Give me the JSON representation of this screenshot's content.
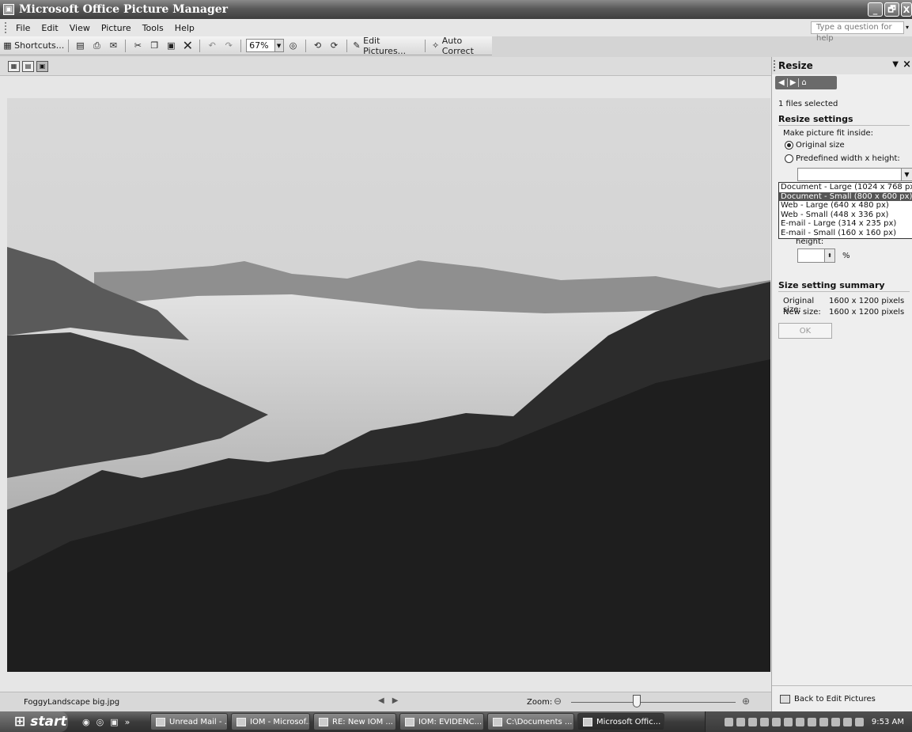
{
  "window": {
    "title": "Microsoft Office Picture Manager",
    "controls": {
      "minimize": "_",
      "maximize": "🗗",
      "close": "X"
    }
  },
  "menu": {
    "items": [
      "File",
      "Edit",
      "View",
      "Picture",
      "Tools",
      "Help"
    ],
    "help_placeholder": "Type a question for help"
  },
  "toolbar": {
    "shortcuts_label": "Shortcuts...",
    "zoom_value": "67%",
    "edit_pictures_label": "Edit Pictures...",
    "auto_correct_label": "Auto Correct"
  },
  "status": {
    "filename": "FoggyLandscape big.jpg",
    "zoom_label": "Zoom:"
  },
  "pane": {
    "title": "Resize",
    "files_selected": "1 files selected",
    "resize_settings_header": "Resize settings",
    "fit_label": "Make picture fit inside:",
    "options": [
      {
        "label": "Original size",
        "selected": true
      },
      {
        "label": "Predefined width x height:",
        "selected": false
      }
    ],
    "predefined_list": [
      "Document - Large (1024 x 768 px)",
      "Document - Small (800 x 600 px)",
      "Web - Large (640 x 480 px)",
      "Web - Small (448 x 336 px)",
      "E-mail - Large (314 x 235 px)",
      "E-mail - Small (160 x 160 px)"
    ],
    "highlighted_index": 1,
    "height_label": "height:",
    "percent_sign": "%",
    "summary_header": "Size setting summary",
    "original_size_label": "Original size:",
    "original_size_value": "1600 x 1200 pixels",
    "new_size_label": "New size:",
    "new_size_value": "1600 x 1200 pixels",
    "ok_label": "OK",
    "back_link": "Back to Edit Pictures"
  },
  "taskbar": {
    "start_label": "start",
    "tasks": [
      {
        "label": "Unread Mail - ...",
        "active": false
      },
      {
        "label": "IOM - Microsof...",
        "active": false
      },
      {
        "label": "RE: New IOM ...",
        "active": false
      },
      {
        "label": "IOM: EVIDENC...",
        "active": false
      },
      {
        "label": "C:\\Documents ...",
        "active": false
      },
      {
        "label": "Microsoft Offic...",
        "active": true
      }
    ],
    "clock": "9:53 AM"
  }
}
